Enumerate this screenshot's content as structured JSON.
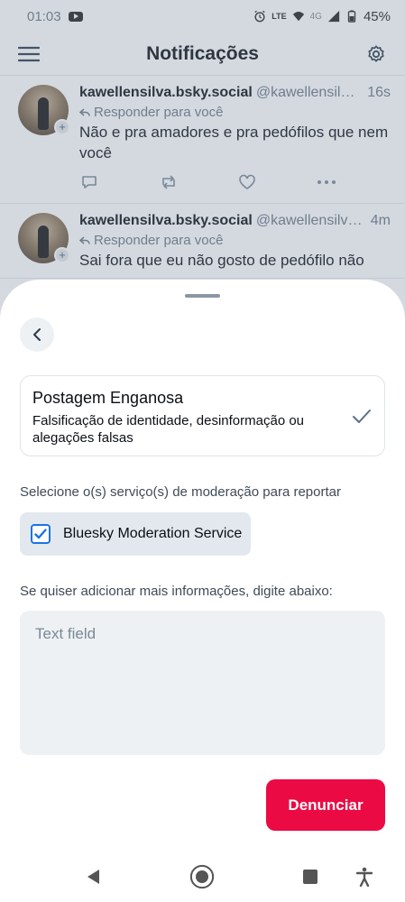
{
  "status_bar": {
    "time": "01:03",
    "network": "LTE",
    "signal_label": "4G",
    "battery": "45%"
  },
  "header": {
    "title": "Notificações"
  },
  "notifications": [
    {
      "author": "kawellensilva.bsky.social",
      "handle": "@kawellensilva.bsky.social",
      "time": "16s",
      "reply_to": "Responder para você",
      "text": "Não e pra amadores e pra pedófilos que nem você"
    },
    {
      "author": "kawellensilva.bsky.social",
      "handle": "@kawellensilva.bsky.social",
      "time": "4m",
      "reply_to": "Responder para você",
      "text": "Sai fora que eu não gosto de pedófilo não"
    }
  ],
  "report_sheet": {
    "reason": {
      "title": "Postagem Enganosa",
      "description": "Falsificação de identidade, desinformação ou alegações falsas"
    },
    "select_label": "Selecione o(s) serviço(s) de moderação para reportar",
    "service": {
      "label": "Bluesky Moderation Service",
      "checked": true
    },
    "details_label": "Se quiser adicionar mais informações, digite abaixo:",
    "details_placeholder": "Text field",
    "details_value": "",
    "submit_label": "Denunciar"
  },
  "colors": {
    "accent": "#1b74e4",
    "danger": "#ec0a44",
    "muted_text": "#6b7884",
    "sheet_overlay": "#788a9e"
  }
}
